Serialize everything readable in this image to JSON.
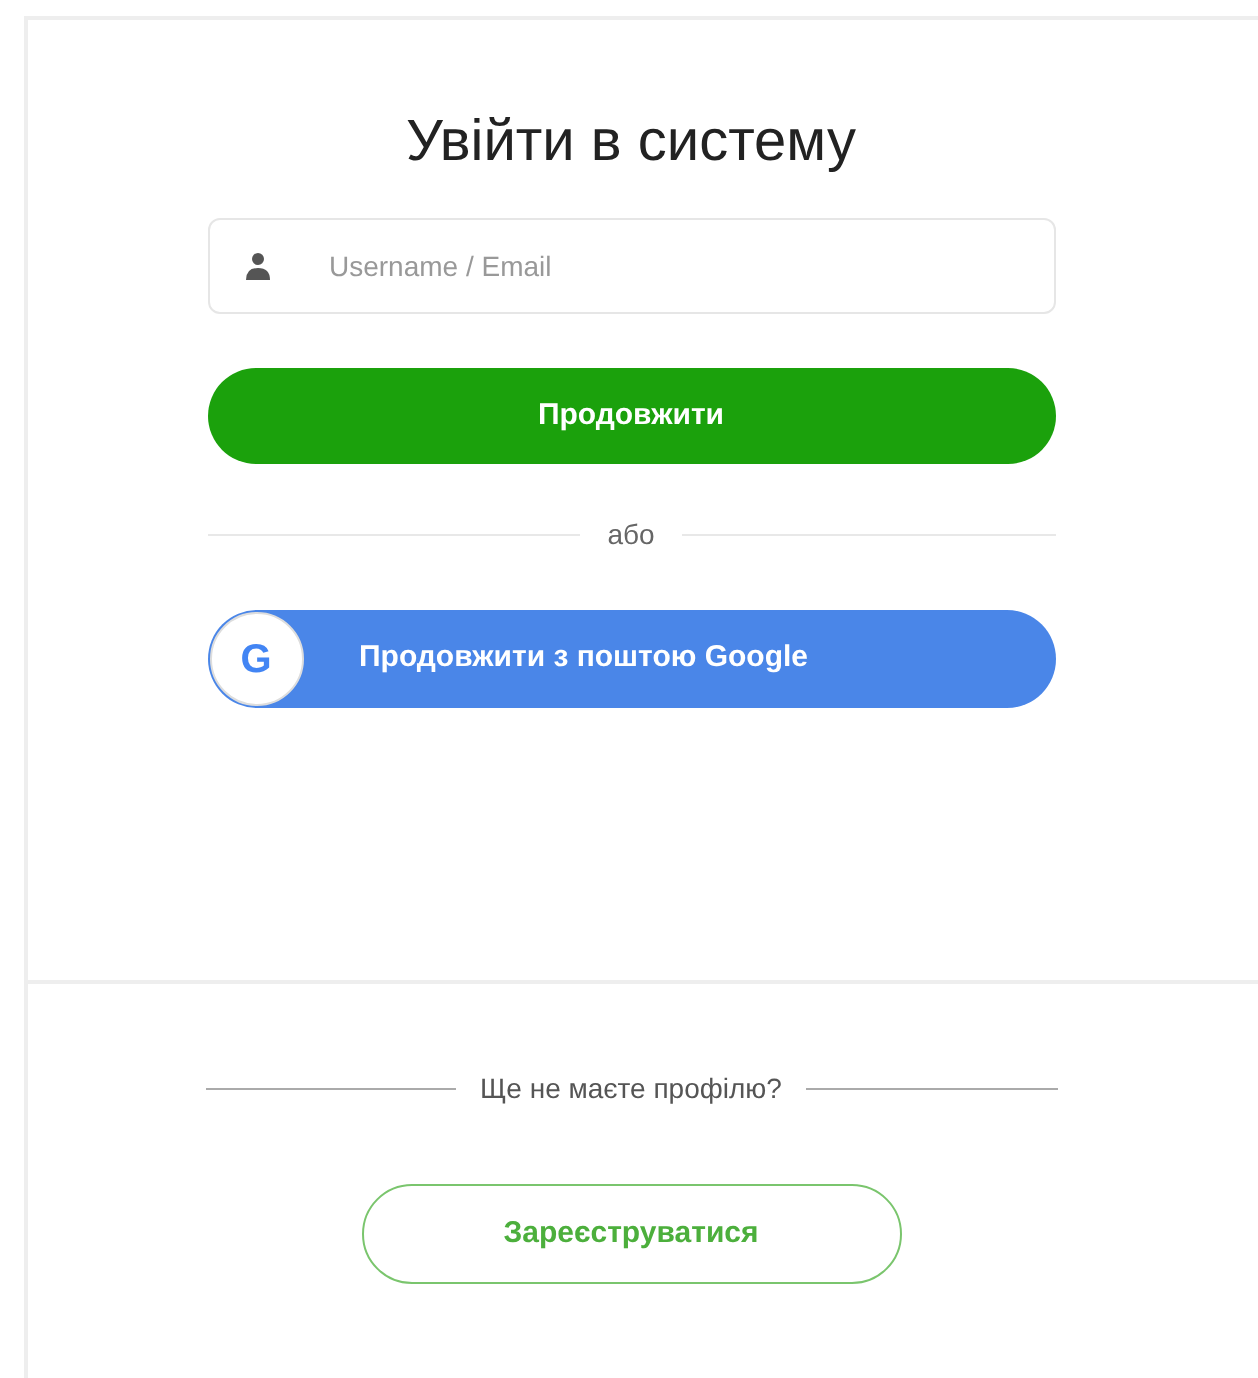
{
  "title": "Увійти в систему",
  "login": {
    "placeholder": "Username / Email"
  },
  "continue_button": "Продовжити",
  "separator": "або",
  "google_button": {
    "icon_letter": "G",
    "label": "Продовжити з поштою Google"
  },
  "signup": {
    "prompt": "Ще не маєте профілю?",
    "button": "Зареєструватися"
  }
}
